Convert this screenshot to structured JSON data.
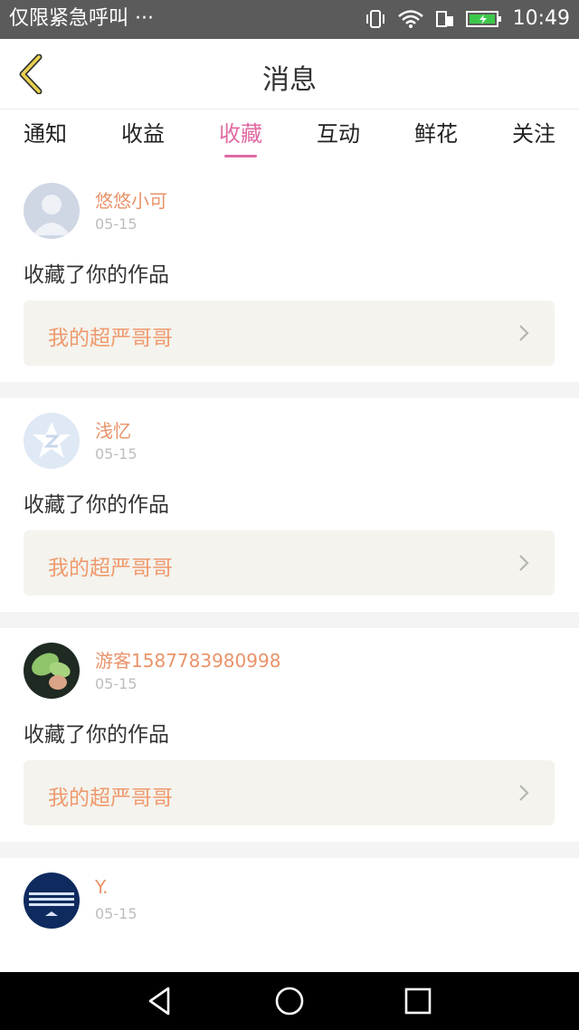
{
  "status_bar": {
    "notice": "仅限紧急呼叫 ···",
    "time": "10:49"
  },
  "header": {
    "title": "消息",
    "back_icon": "chevron-left-icon"
  },
  "tabs": [
    {
      "label": "通知",
      "active": false
    },
    {
      "label": "收益",
      "active": false
    },
    {
      "label": "收藏",
      "active": true
    },
    {
      "label": "互动",
      "active": false
    },
    {
      "label": "鲜花",
      "active": false
    },
    {
      "label": "关注",
      "active": false
    }
  ],
  "messages": [
    {
      "user": "悠悠小可",
      "date": "05-15",
      "action": "收藏了你的作品",
      "work": "我的超严哥哥"
    },
    {
      "user": "浅忆",
      "date": "05-15",
      "action": "收藏了你的作品",
      "work": "我的超严哥哥"
    },
    {
      "user": "游客1587783980998",
      "date": "05-15",
      "action": "收藏了你的作品",
      "work": "我的超严哥哥"
    },
    {
      "user": "Y.",
      "date": "05-15"
    }
  ],
  "colors": {
    "accent": "#e06aa2",
    "username": "#e9936a",
    "work_title": "#ef9a6e",
    "work_box_bg": "#f4f3ed",
    "status_bar_bg": "#5b5b5b"
  }
}
